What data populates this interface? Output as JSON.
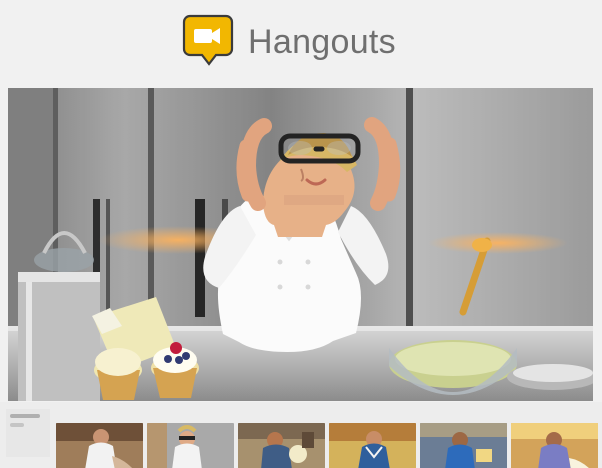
{
  "header": {
    "app_title": "Hangouts",
    "logo_icon": "hangouts-video-logo-icon"
  },
  "main_video": {
    "scene": "chef-in-kitchen-video-frame"
  },
  "participants": {
    "label_rows": [
      "",
      ""
    ],
    "thumbnails": [
      {
        "icon": "participant-video-thumbnail"
      },
      {
        "icon": "participant-video-thumbnail"
      },
      {
        "icon": "participant-video-thumbnail"
      },
      {
        "icon": "participant-video-thumbnail"
      },
      {
        "icon": "participant-video-thumbnail"
      },
      {
        "icon": "participant-video-thumbnail"
      }
    ]
  },
  "colors": {
    "page_background": "#f1f1f1",
    "brand_yellow": "#f2b701",
    "title_gray": "#6f6f6f"
  }
}
